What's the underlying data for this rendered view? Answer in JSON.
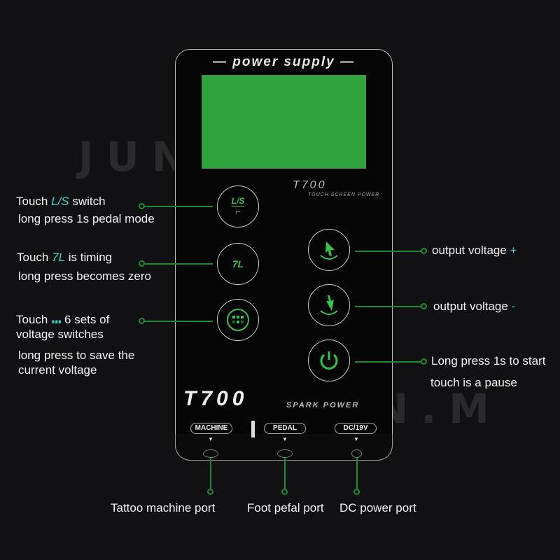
{
  "watermark": "JUN.M",
  "device": {
    "title": "— power supply —",
    "model_small": "T700",
    "model_small_sub": "TOUCH SCREEN POWER",
    "model_large": "T700",
    "model_large_sub": "SPARK POWER",
    "buttons": {
      "ls": "L/S",
      "timer": "7L"
    },
    "ports": [
      {
        "tag": "MACHINE",
        "caption": "Tattoo machine port"
      },
      {
        "tag": "PEDAL",
        "caption": "Foot pefal port"
      },
      {
        "tag": "DC/19V",
        "caption": "DC power port"
      }
    ],
    "screen_color": "#2fa33c",
    "accent": "#37c24a"
  },
  "left_callouts": [
    {
      "pre": "Touch",
      "key": "L/S",
      "post": "switch",
      "line2": "long press 1s pedal mode"
    },
    {
      "pre": "Touch",
      "key": "7L",
      "post": "is timing",
      "line2": "long press becomes zero"
    },
    {
      "pre": "Touch",
      "key": "∎∎∎",
      "post": "6 sets of",
      "line2": "voltage switches",
      "line3": "long press to save the",
      "line4": "current voltage"
    }
  ],
  "right_callouts": [
    {
      "text": "output voltage",
      "sign": "+"
    },
    {
      "text": "output voltage",
      "sign": "-"
    },
    {
      "text": "Long press 1s to start",
      "line2": "touch is a pause"
    }
  ]
}
